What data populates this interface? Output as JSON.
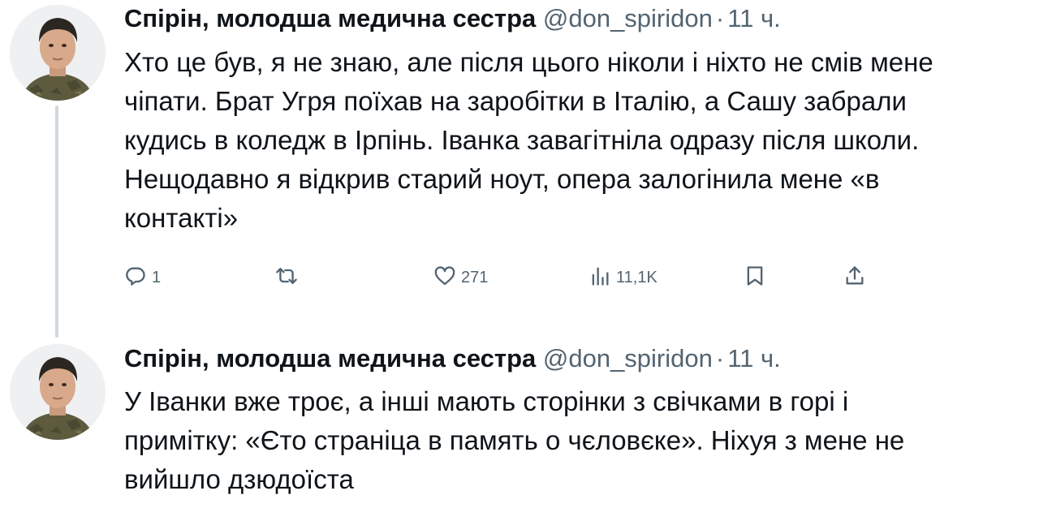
{
  "tweets": [
    {
      "author": {
        "name": "Спірін, молодша медична сестра",
        "handle": "@don_spiridon"
      },
      "separator": "·",
      "time": "11 ч.",
      "lines": [
        "Хто це був, я не знаю, але після цього ніколи і ніхто не смів мене",
        "чіпати. Брат Угря поїхав на заробітки в Італію, а Сашу забрали",
        "кудись в коледж в Ірпінь. Іванка завагітніла одразу після школи.",
        "Нещодавно я відкрив старий ноут, опера залогінила мене «в",
        "контакті»"
      ],
      "actions": {
        "reply": {
          "icon": "reply-icon",
          "count": "1"
        },
        "retweet": {
          "icon": "retweet-icon",
          "count": ""
        },
        "like": {
          "icon": "heart-icon",
          "count": "271"
        },
        "views": {
          "icon": "views-icon",
          "count": "11,1K"
        },
        "bookmark": {
          "icon": "bookmark-icon"
        },
        "share": {
          "icon": "share-icon"
        }
      }
    },
    {
      "author": {
        "name": "Спірін, молодша медична сестра",
        "handle": "@don_spiridon"
      },
      "separator": "·",
      "time": "11 ч.",
      "lines": [
        "У Іванки вже троє, а  інші мають сторінки з свічками в горі і",
        "примітку: «Єто страніца в память о чєловєке». Ніхуя з мене не",
        "вийшло дзюдоїста"
      ]
    }
  ],
  "colors": {
    "text": "#0f1419",
    "secondary": "#536471",
    "thread_line": "#cfd9de",
    "background": "#ffffff"
  }
}
